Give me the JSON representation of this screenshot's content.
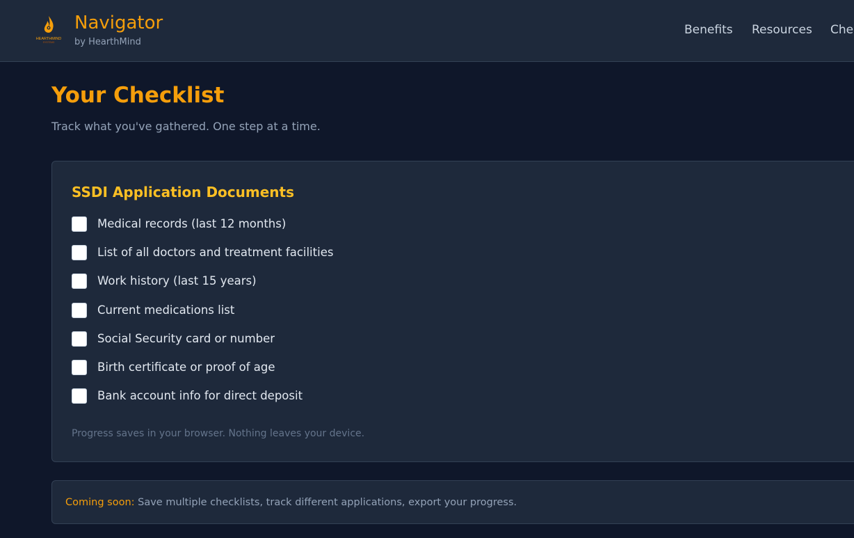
{
  "header": {
    "brand_title": "Navigator",
    "brand_subtitle": "by HearthMind",
    "logo_text": "HEARTHMIND",
    "logo_subtext": "SYSTEMS",
    "nav": [
      {
        "label": "Benefits"
      },
      {
        "label": "Resources"
      },
      {
        "label": "Checklist"
      }
    ]
  },
  "main": {
    "title": "Your Checklist",
    "subtitle": "Track what you've gathered. One step at a time."
  },
  "checklist": {
    "title": "SSDI Application Documents",
    "items": [
      {
        "label": "Medical records (last 12 months)",
        "checked": false
      },
      {
        "label": "List of all doctors and treatment facilities",
        "checked": false
      },
      {
        "label": "Work history (last 15 years)",
        "checked": false
      },
      {
        "label": "Current medications list",
        "checked": false
      },
      {
        "label": "Social Security card or number",
        "checked": false
      },
      {
        "label": "Birth certificate or proof of age",
        "checked": false
      },
      {
        "label": "Bank account info for direct deposit",
        "checked": false
      }
    ],
    "note": "Progress saves in your browser. Nothing leaves your device."
  },
  "coming_soon": {
    "label": "Coming soon:",
    "text": " Save multiple checklists, track different applications, export your progress."
  },
  "colors": {
    "accent": "#f59e0b",
    "background": "#0f172a",
    "surface": "#1e293b"
  }
}
